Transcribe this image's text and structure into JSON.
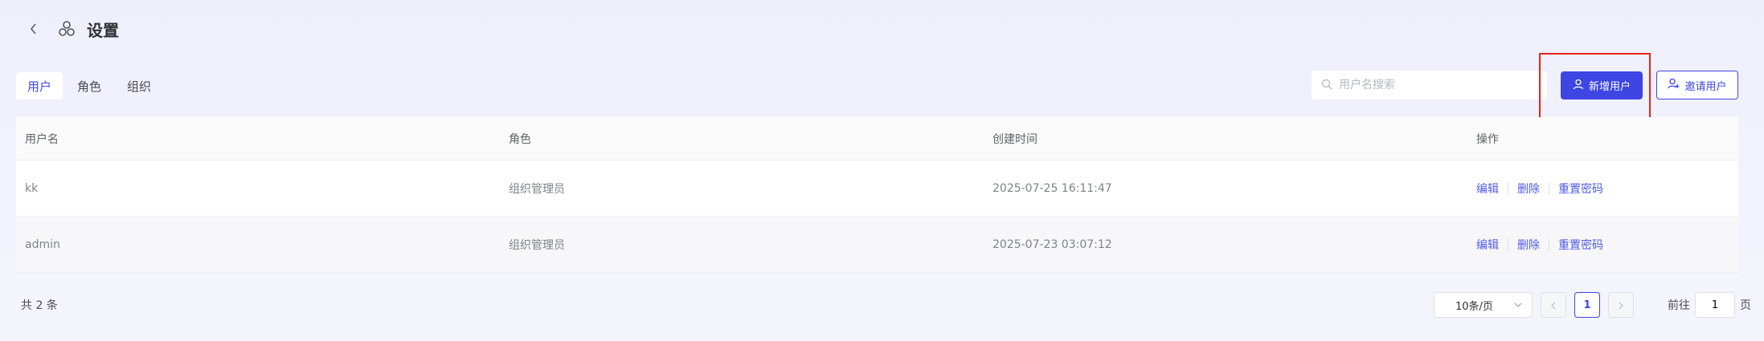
{
  "header": {
    "title": "设置"
  },
  "tabs": [
    "用户",
    "角色",
    "组织"
  ],
  "search": {
    "placeholder": "用户名搜索",
    "value": ""
  },
  "buttons": {
    "add_user": "新增用户",
    "invite_user": "邀请用户"
  },
  "table": {
    "columns": [
      "用户名",
      "角色",
      "创建时间",
      "操作"
    ],
    "rows": [
      {
        "username": "kk",
        "role": "组织管理员",
        "created": "2025-07-25 16:11:47"
      },
      {
        "username": "admin",
        "role": "组织管理员",
        "created": "2025-07-23 03:07:12"
      }
    ],
    "actions": {
      "edit": "编辑",
      "delete": "删除",
      "reset": "重置密码"
    }
  },
  "pagination": {
    "total_text": "共 2 条",
    "page_size": "10条/页",
    "current_page": "1",
    "goto_prefix": "前往",
    "goto_value": "1",
    "goto_suffix": "页"
  },
  "colors": {
    "primary": "#3d45e3",
    "highlight": "#e5231b"
  },
  "icons": {
    "back": "chevron-left-icon",
    "app": "cluster-icon",
    "search": "search-icon",
    "add": "user-icon",
    "invite": "user-plus-icon"
  }
}
